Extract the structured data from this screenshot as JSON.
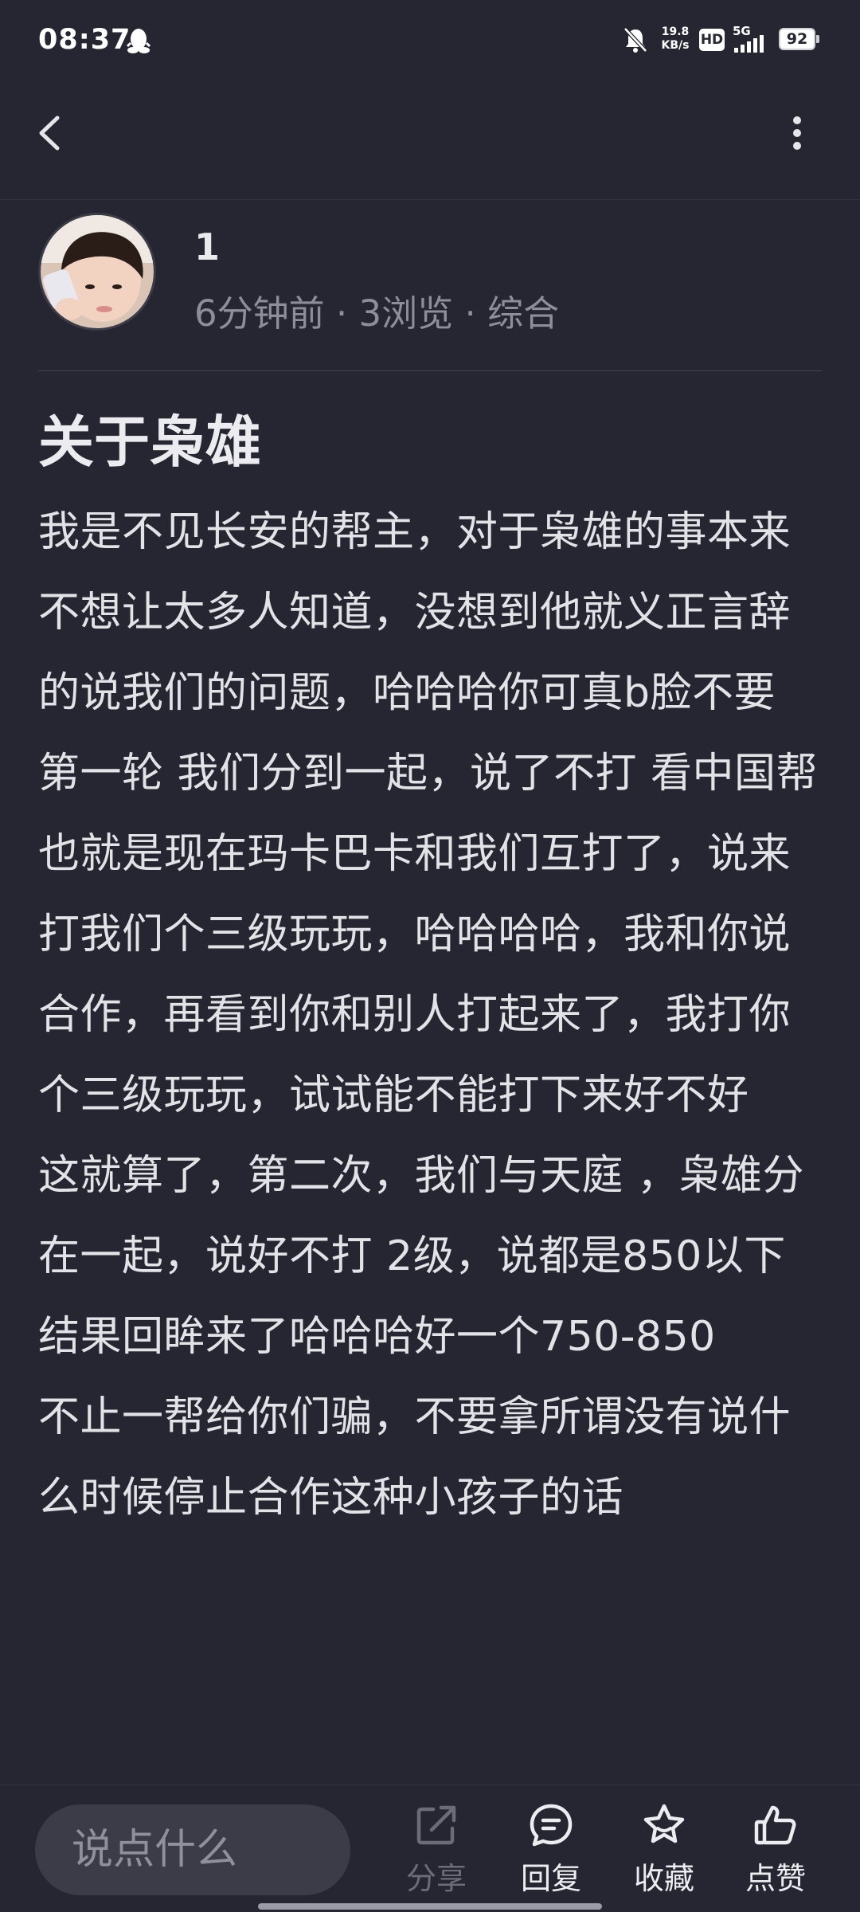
{
  "status_bar": {
    "time": "08:37",
    "speed_value": "19.8",
    "speed_unit": "KB/s",
    "hd_badge": "HD",
    "network": "5G",
    "battery": "92",
    "icons": [
      "qq-penguin-icon",
      "bell-muted-icon",
      "signal-icon"
    ]
  },
  "nav": {
    "back_icon": "chevron-left-icon",
    "more_icon": "more-vertical-icon"
  },
  "author": {
    "name": "1",
    "meta": "6分钟前 · 3浏览 · 综合"
  },
  "post": {
    "title": "关于枭雄",
    "paragraphs": [
      "我是不见长安的帮主，对于枭雄的事本来不想让太多人知道，没想到他就义正言辞的说我们的问题，哈哈哈你可真b脸不要",
      "第一轮 我们分到一起，说了不打 看中国帮也就是现在玛卡巴卡和我们互打了，说来打我们个三级玩玩，哈哈哈哈，我和你说合作，再看到你和别人打起来了，我打你个三级玩玩，试试能不能打下来好不好",
      "这就算了，第二次，我们与天庭 ，枭雄分在一起，说好不打 2级，说都是850以下 结果回眸来了哈哈哈好一个750-850",
      "不止一帮给你们骗，不要拿所谓没有说什么时候停止合作这种小孩子的话"
    ]
  },
  "bottom_bar": {
    "input_placeholder": "说点什么",
    "share_label": "分享",
    "reply_label": "回复",
    "favorite_label": "收藏",
    "like_label": "点赞",
    "share_color": "#6b6c77",
    "active_color": "#ededf1"
  },
  "colors": {
    "background": "#252631",
    "text_primary": "#e2e2e7",
    "text_secondary": "#8d8e99",
    "input_background": "#3b3c48"
  }
}
